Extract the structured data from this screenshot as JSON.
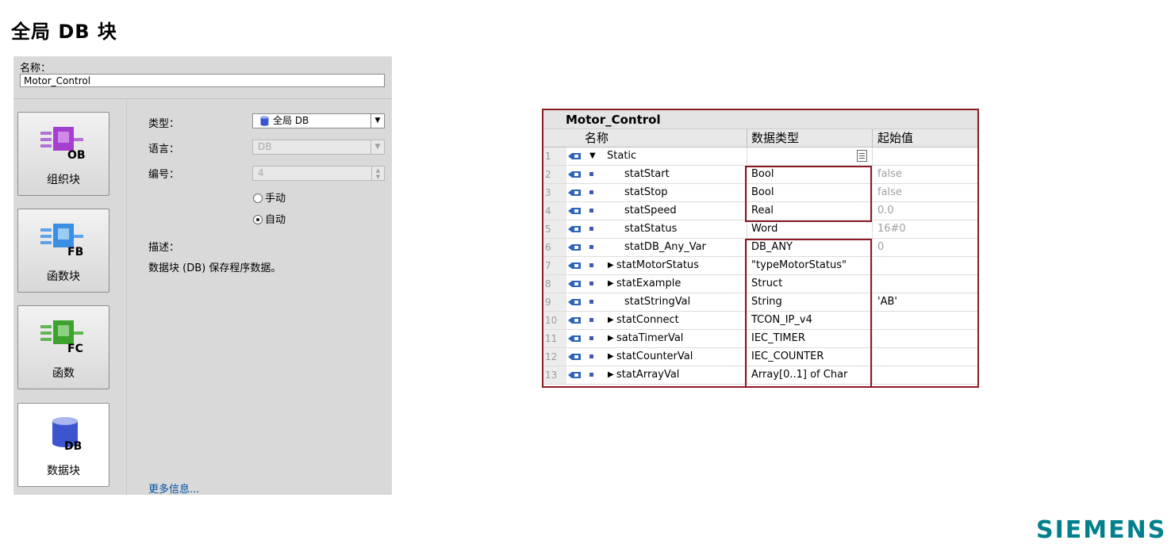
{
  "page": {
    "title": "全局 DB 块"
  },
  "dialog": {
    "name_label": "名称：",
    "name_value": "Motor_Control",
    "block_types": [
      {
        "label": "组织块",
        "icon_text": "OB",
        "color": "#a53fd0"
      },
      {
        "label": "函数块",
        "icon_text": "FB",
        "color": "#3a8fe3"
      },
      {
        "label": "函数",
        "icon_text": "FC",
        "color": "#3da22e"
      },
      {
        "label": "数据块",
        "icon_text": "DB",
        "color": "#3c55cf"
      }
    ],
    "type_label": "类型：",
    "type_value": "全局 DB",
    "language_label": "语言：",
    "language_value": "DB",
    "number_label": "编号：",
    "number_value": "4",
    "radio_manual": "手动",
    "radio_auto": "自动",
    "description_label": "描述：",
    "description_text": "数据块 (DB) 保存程序数据。",
    "more_info": "更多信息..."
  },
  "db_table": {
    "title": "Motor_Control",
    "headers": {
      "name": "名称",
      "data_type": "数据类型",
      "start_value": "起始值"
    },
    "rows": [
      {
        "num": "1",
        "name": "Static",
        "expander": "▼",
        "data_type": "",
        "start_value": ""
      },
      {
        "num": "2",
        "name": "statStart",
        "expander": "",
        "data_type": "Bool",
        "start_value": "false"
      },
      {
        "num": "3",
        "name": "statStop",
        "expander": "",
        "data_type": "Bool",
        "start_value": "false"
      },
      {
        "num": "4",
        "name": "statSpeed",
        "expander": "",
        "data_type": "Real",
        "start_value": "0.0"
      },
      {
        "num": "5",
        "name": "statStatus",
        "expander": "",
        "data_type": "Word",
        "start_value": "16#0"
      },
      {
        "num": "6",
        "name": "statDB_Any_Var",
        "expander": "",
        "data_type": "DB_ANY",
        "start_value": "0"
      },
      {
        "num": "7",
        "name": "statMotorStatus",
        "expander": "▶",
        "data_type": "\"typeMotorStatus\"",
        "start_value": ""
      },
      {
        "num": "8",
        "name": "statExample",
        "expander": "▶",
        "data_type": "Struct",
        "start_value": ""
      },
      {
        "num": "9",
        "name": "statStringVal",
        "expander": "",
        "data_type": "String",
        "start_value": "'AB'"
      },
      {
        "num": "10",
        "name": "statConnect",
        "expander": "▶",
        "data_type": "TCON_IP_v4",
        "start_value": ""
      },
      {
        "num": "11",
        "name": "sataTimerVal",
        "expander": "▶",
        "data_type": "IEC_TIMER",
        "start_value": ""
      },
      {
        "num": "12",
        "name": "statCounterVal",
        "expander": "▶",
        "data_type": "IEC_COUNTER",
        "start_value": ""
      },
      {
        "num": "13",
        "name": "statArrayVal",
        "expander": "▶",
        "data_type": "Array[0..1] of Char",
        "start_value": ""
      }
    ]
  },
  "brand": {
    "logo_text": "SIEMENS",
    "color": "#00808c"
  }
}
